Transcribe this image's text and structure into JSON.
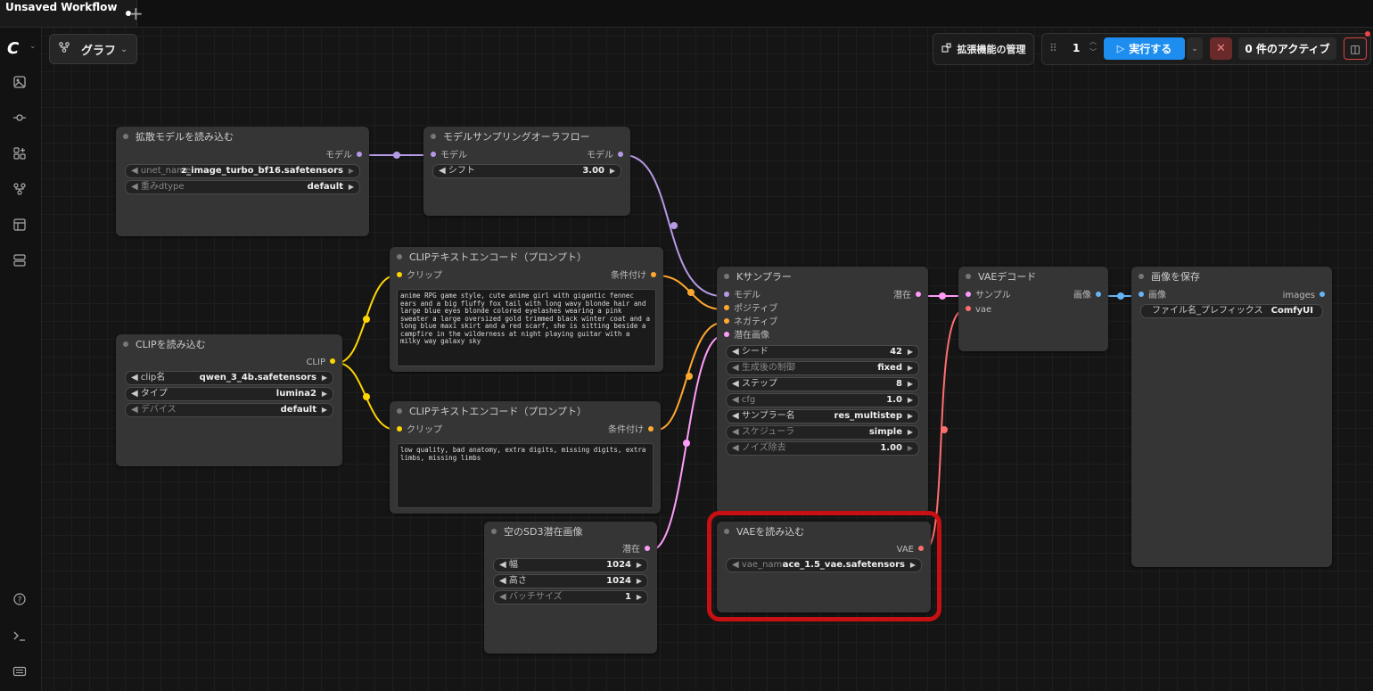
{
  "tab": {
    "title": "Unsaved Workflow",
    "add": "+"
  },
  "header": {
    "graph_label": "グラフ",
    "extensions_label": "拡張機能の管理",
    "count": "1",
    "run_label": "実行する",
    "queue_label": "0 件のアクティブ"
  },
  "sidebar": {
    "logo": "C",
    "icons": [
      "images-icon",
      "nodes-icon",
      "model-library-icon",
      "workflows-icon",
      "templates-icon",
      "queue-icon",
      "help-icon",
      "terminal-icon",
      "keyboard-icon"
    ]
  },
  "colors": {
    "model": "#b59ae6",
    "clip": "#ffd500",
    "conditioning": "#ffa931",
    "latent": "#ff9cf9",
    "vae": "#ff6e6e",
    "image": "#64b5f6",
    "run": "#1d8ef0",
    "highlight": "#c80f12"
  },
  "nodes": {
    "load_diffusion": {
      "title": "拡散モデルを読み込む",
      "out_model": "モデル",
      "w1_label": "unet_name",
      "w1_value": "z_image_turbo_bf16.safetensors",
      "w2_label": "重みdtype",
      "w2_value": "default"
    },
    "model_sampling": {
      "title": "モデルサンプリングオーラフロー",
      "in_model": "モデル",
      "out_model": "モデル",
      "w1_label": "シフト",
      "w1_value": "3.00"
    },
    "clip_text_pos": {
      "title": "CLIPテキストエンコード（プロンプト）",
      "in_clip": "クリップ",
      "out_cond": "条件付け",
      "text": "anime RPG game style, cute anime girl with gigantic fennec ears and a big fluffy fox tail with long wavy blonde hair and large blue eyes blonde colored eyelashes wearing a pink sweater a large oversized gold trimmed black winter coat and a long blue maxi skirt and a red scarf, she is sitting beside a campfire in the wilderness at night playing guitar with a milky way galaxy sky"
    },
    "clip_text_neg": {
      "title": "CLIPテキストエンコード（プロンプト）",
      "in_clip": "クリップ",
      "out_cond": "条件付け",
      "text": "low quality, bad anatomy, extra digits, missing digits, extra limbs, missing limbs"
    },
    "load_clip": {
      "title": "CLIPを読み込む",
      "out_clip": "CLIP",
      "w1_label": "clip名",
      "w1_value": "qwen_3_4b.safetensors",
      "w2_label": "タイプ",
      "w2_value": "lumina2",
      "w3_label": "デバイス",
      "w3_value": "default"
    },
    "ksampler": {
      "title": "Kサンプラー",
      "in_model": "モデル",
      "in_pos": "ポジティブ",
      "in_neg": "ネガティブ",
      "in_latent": "潜在画像",
      "out_latent": "潜在",
      "w1_label": "シード",
      "w1_value": "42",
      "w2_label": "生成後の制御",
      "w2_value": "fixed",
      "w3_label": "ステップ",
      "w3_value": "8",
      "w4_label": "cfg",
      "w4_value": "1.0",
      "w5_label": "サンプラー名",
      "w5_value": "res_multistep",
      "w6_label": "スケジューラ",
      "w6_value": "simple",
      "w7_label": "ノイズ除去",
      "w7_value": "1.00"
    },
    "vae_decode": {
      "title": "VAEデコード",
      "in_samples": "サンプル",
      "in_vae": "vae",
      "out_image": "画像"
    },
    "save_image": {
      "title": "画像を保存",
      "in_images": "画像",
      "out_images": "images",
      "w1_label": "ファイル名_プレフィックス",
      "w1_value": "ComfyUI"
    },
    "empty_latent": {
      "title": "空のSD3潜在画像",
      "out_latent": "潜在",
      "w1_label": "幅",
      "w1_value": "1024",
      "w2_label": "高さ",
      "w2_value": "1024",
      "w3_label": "バッチサイズ",
      "w3_value": "1"
    },
    "load_vae": {
      "title": "VAEを読み込む",
      "out_vae": "VAE",
      "w1_label": "vae_name",
      "w1_value": "ace_1.5_vae.safetensors"
    }
  }
}
